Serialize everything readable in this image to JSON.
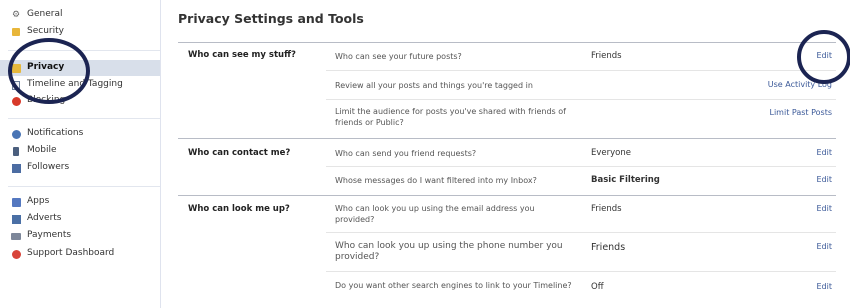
{
  "sidebar": {
    "items": [
      {
        "label": "General",
        "icon": "gear-icon"
      },
      {
        "label": "Security",
        "icon": "lock-icon"
      },
      {
        "label": "Privacy",
        "icon": "privacy-icon"
      },
      {
        "label": "Timeline and Tagging",
        "icon": "timeline-icon"
      },
      {
        "label": "Blocking",
        "icon": "blocking-icon"
      },
      {
        "label": "Notifications",
        "icon": "globe-icon"
      },
      {
        "label": "Mobile",
        "icon": "mobile-icon"
      },
      {
        "label": "Followers",
        "icon": "followers-icon"
      },
      {
        "label": "Apps",
        "icon": "apps-icon"
      },
      {
        "label": "Adverts",
        "icon": "adverts-icon"
      },
      {
        "label": "Payments",
        "icon": "payments-icon"
      },
      {
        "label": "Support Dashboard",
        "icon": "support-icon"
      }
    ],
    "active": "Privacy"
  },
  "main": {
    "title": "Privacy Settings and Tools",
    "sections": [
      {
        "label": "Who can see my stuff?",
        "rows": [
          {
            "question": "Who can see your future posts?",
            "value": "Friends",
            "action": "Edit"
          },
          {
            "question": "Review all your posts and things you're tagged in",
            "value": "",
            "action": "Use Activity Log"
          },
          {
            "question": "Limit the audience for posts you've shared with friends of friends or Public?",
            "value": "",
            "action": "Limit Past Posts"
          }
        ]
      },
      {
        "label": "Who can contact me?",
        "rows": [
          {
            "question": "Who can send you friend requests?",
            "value": "Everyone",
            "action": "Edit"
          },
          {
            "question": "Whose messages do I want filtered into my Inbox?",
            "value": "Basic Filtering",
            "action": "Edit"
          }
        ]
      },
      {
        "label": "Who can look me up?",
        "rows": [
          {
            "question": "Who can look you up using the email address you provided?",
            "value": "Friends",
            "action": "Edit"
          },
          {
            "question": "Who can look you up using the phone number you provided?",
            "value": "Friends",
            "action": "Edit"
          },
          {
            "question": "Do you want other search engines to link to your Timeline?",
            "value": "Off",
            "action": "Edit"
          }
        ]
      }
    ]
  },
  "colors": {
    "link": "#3b5998",
    "active_bg": "#d8dfea",
    "annotation_circle": "#1b2452"
  }
}
